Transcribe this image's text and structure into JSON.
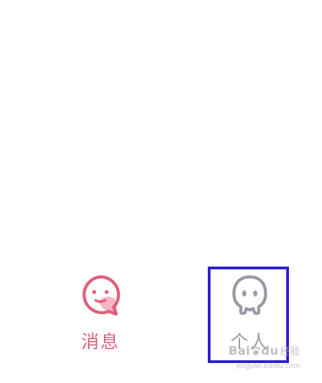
{
  "tabs": [
    {
      "label": "消息",
      "icon": "chat-bubble-smile-icon",
      "active": true,
      "color": "#e0607a"
    },
    {
      "label": "个人",
      "icon": "ghost-avatar-icon",
      "active": false,
      "color": "#9a9aa6"
    }
  ],
  "highlight": {
    "color": "#2b1fd0",
    "target": "tab-profile"
  },
  "watermark": {
    "brand_prefix": "Bai",
    "brand_mid": "du",
    "brand_suffix": "经验",
    "url": "jingyan.baidu.com"
  }
}
